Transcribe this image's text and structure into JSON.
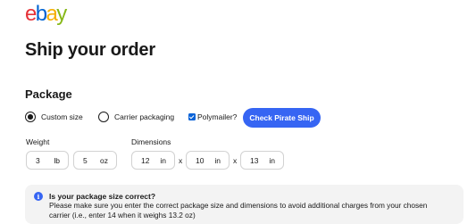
{
  "logo": {
    "letters": [
      "e",
      "b",
      "a",
      "y"
    ],
    "colors": [
      "#e53238",
      "#0064d2",
      "#f5af02",
      "#86b817"
    ]
  },
  "page": {
    "title": "Ship your order"
  },
  "package": {
    "section_title": "Package",
    "options": [
      {
        "label": "Custom size",
        "selected": true
      },
      {
        "label": "Carrier packaging",
        "selected": false
      }
    ],
    "polymailer": {
      "label": "Polymailer?",
      "checked": true
    },
    "check_button_label": "Check Pirate Ship"
  },
  "weight": {
    "label": "Weight",
    "fields": [
      {
        "value": "3",
        "unit": "lb"
      },
      {
        "value": "5",
        "unit": "oz"
      }
    ]
  },
  "dimensions": {
    "label": "Dimensions",
    "separator": "x",
    "fields": [
      {
        "value": "12",
        "unit": "in"
      },
      {
        "value": "10",
        "unit": "in"
      },
      {
        "value": "13",
        "unit": "in"
      }
    ]
  },
  "notice": {
    "icon": "info-icon",
    "title": "Is your package size correct?",
    "body": "Please make sure you enter the correct package size and dimensions to avoid additional charges from your chosen carrier (i.e., enter 14 when it weighs 13.2 oz)"
  },
  "colors": {
    "accent": "#3665f3",
    "checkbox": "#0a63d8",
    "notice_bg": "#f3f3f3",
    "field_border": "#d2d2d2"
  }
}
